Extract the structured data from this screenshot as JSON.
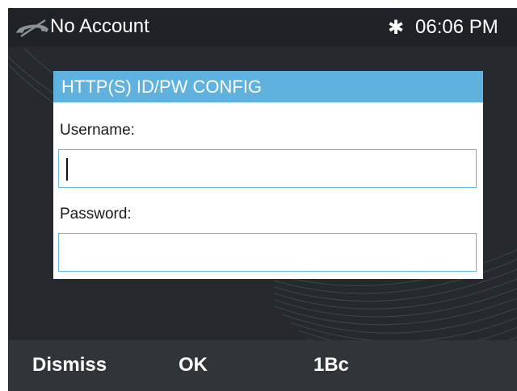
{
  "status": {
    "account": "No Account",
    "bluetooth_icon": "bluetooth-icon",
    "handset_icon": "handset-icon",
    "time": "06:06 PM"
  },
  "dialog": {
    "title": "HTTP(S) ID/PW CONFIG",
    "username_label": "Username:",
    "username_value": "",
    "password_label": "Password:",
    "password_value": ""
  },
  "softkeys": {
    "dismiss": "Dismiss",
    "ok": "OK",
    "input_mode": "1Bc"
  },
  "colors": {
    "screen_bg": "#262a2e",
    "title_bar": "#5fb1e0",
    "field_border": "#6ab8e6",
    "softkey_bar": "#30353a"
  }
}
